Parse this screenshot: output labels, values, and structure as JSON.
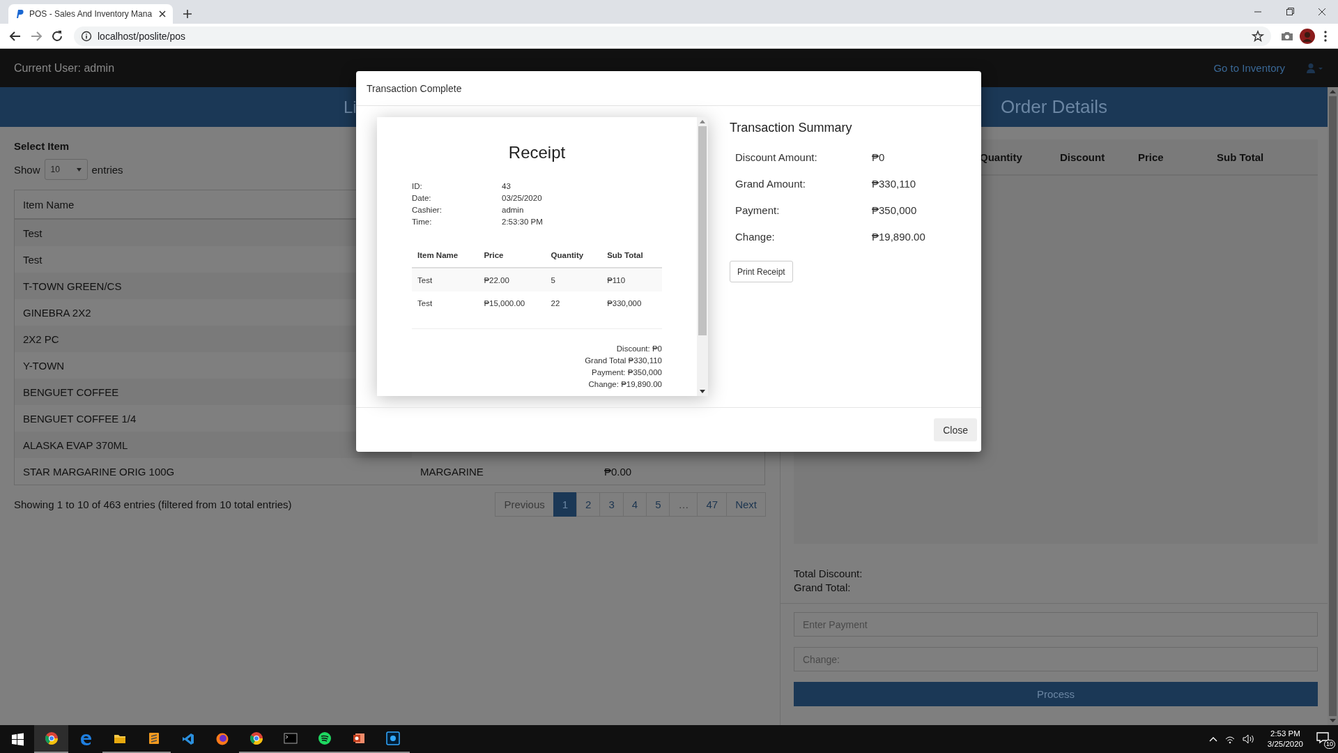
{
  "browser": {
    "tab_title": "POS - Sales And Inventory Mana",
    "url": "localhost/poslite/pos"
  },
  "navbar": {
    "current_user": "Current User: admin",
    "inventory_link": "Go to Inventory"
  },
  "left_panel": {
    "header": "Li",
    "section_title": "Select Item",
    "show_label": "Show",
    "entries_select": "10",
    "entries_label": "entries",
    "columns": [
      "Item Name"
    ],
    "rows": [
      {
        "item_name": "Test"
      },
      {
        "item_name": "Test"
      },
      {
        "item_name": "T-TOWN GREEN/CS"
      },
      {
        "item_name": "GINEBRA 2X2"
      },
      {
        "item_name": "2X2 PC"
      },
      {
        "item_name": "Y-TOWN"
      },
      {
        "item_name": "BENGUET COFFEE"
      },
      {
        "item_name": "BENGUET COFFEE 1/4"
      },
      {
        "item_name": "ALASKA EVAP 370ML"
      },
      {
        "item_name": "STAR MARGARINE ORIG 100G",
        "column_2": "MARGARINE",
        "column_3": "₱0.00"
      }
    ],
    "info": "Showing 1 to 10 of 463 entries (filtered from 10 total entries)",
    "pagination": [
      {
        "label": "Previous",
        "selected": false,
        "disabled": true
      },
      {
        "label": "1",
        "selected": true,
        "disabled": false
      },
      {
        "label": "2",
        "selected": false,
        "disabled": false
      },
      {
        "label": "3",
        "selected": false,
        "disabled": false
      },
      {
        "label": "4",
        "selected": false,
        "disabled": false
      },
      {
        "label": "5",
        "selected": false,
        "disabled": false
      },
      {
        "label": "…",
        "selected": false,
        "disabled": true
      },
      {
        "label": "47",
        "selected": false,
        "disabled": false
      },
      {
        "label": "Next",
        "selected": false,
        "disabled": false
      }
    ]
  },
  "order_panel": {
    "header": "Order Details",
    "columns": [
      "Quantity",
      "Discount",
      "Price",
      "Sub Total"
    ],
    "total_discount": "Total Discount:",
    "grand_total": "Grand Total:",
    "payment_placeholder": "Enter Payment",
    "change_placeholder": "Change:",
    "process_button": "Process"
  },
  "modal": {
    "title": "Transaction Complete",
    "receipt": {
      "title": "Receipt",
      "info": [
        {
          "label": "ID:",
          "value": "43"
        },
        {
          "label": "Date:",
          "value": "03/25/2020"
        },
        {
          "label": "Cashier:",
          "value": "admin"
        },
        {
          "label": "Time:",
          "value": "2:53:30 PM"
        }
      ],
      "columns": [
        "Item Name",
        "Price",
        "Quantity",
        "Sub Total"
      ],
      "rows": [
        [
          "Test",
          "₱22.00",
          "5",
          "₱110"
        ],
        [
          "Test",
          "₱15,000.00",
          "22",
          "₱330,000"
        ]
      ],
      "totals": [
        "Discount: ₱0",
        "Grand Total ₱330,110",
        "Payment: ₱350,000",
        "Change: ₱19,890.00"
      ]
    },
    "summary": {
      "title": "Transaction Summary",
      "rows": [
        {
          "label": "Discount Amount:",
          "value": "₱0"
        },
        {
          "label": "Grand Amount:",
          "value": "₱330,110"
        },
        {
          "label": "Payment:",
          "value": "₱350,000"
        },
        {
          "label": "Change:",
          "value": "₱19,890.00"
        }
      ]
    },
    "print_button": "Print Receipt",
    "close_button": "Close"
  },
  "taskbar": {
    "time": "2:53 PM",
    "date": "3/25/2020",
    "notification_count": "10"
  }
}
